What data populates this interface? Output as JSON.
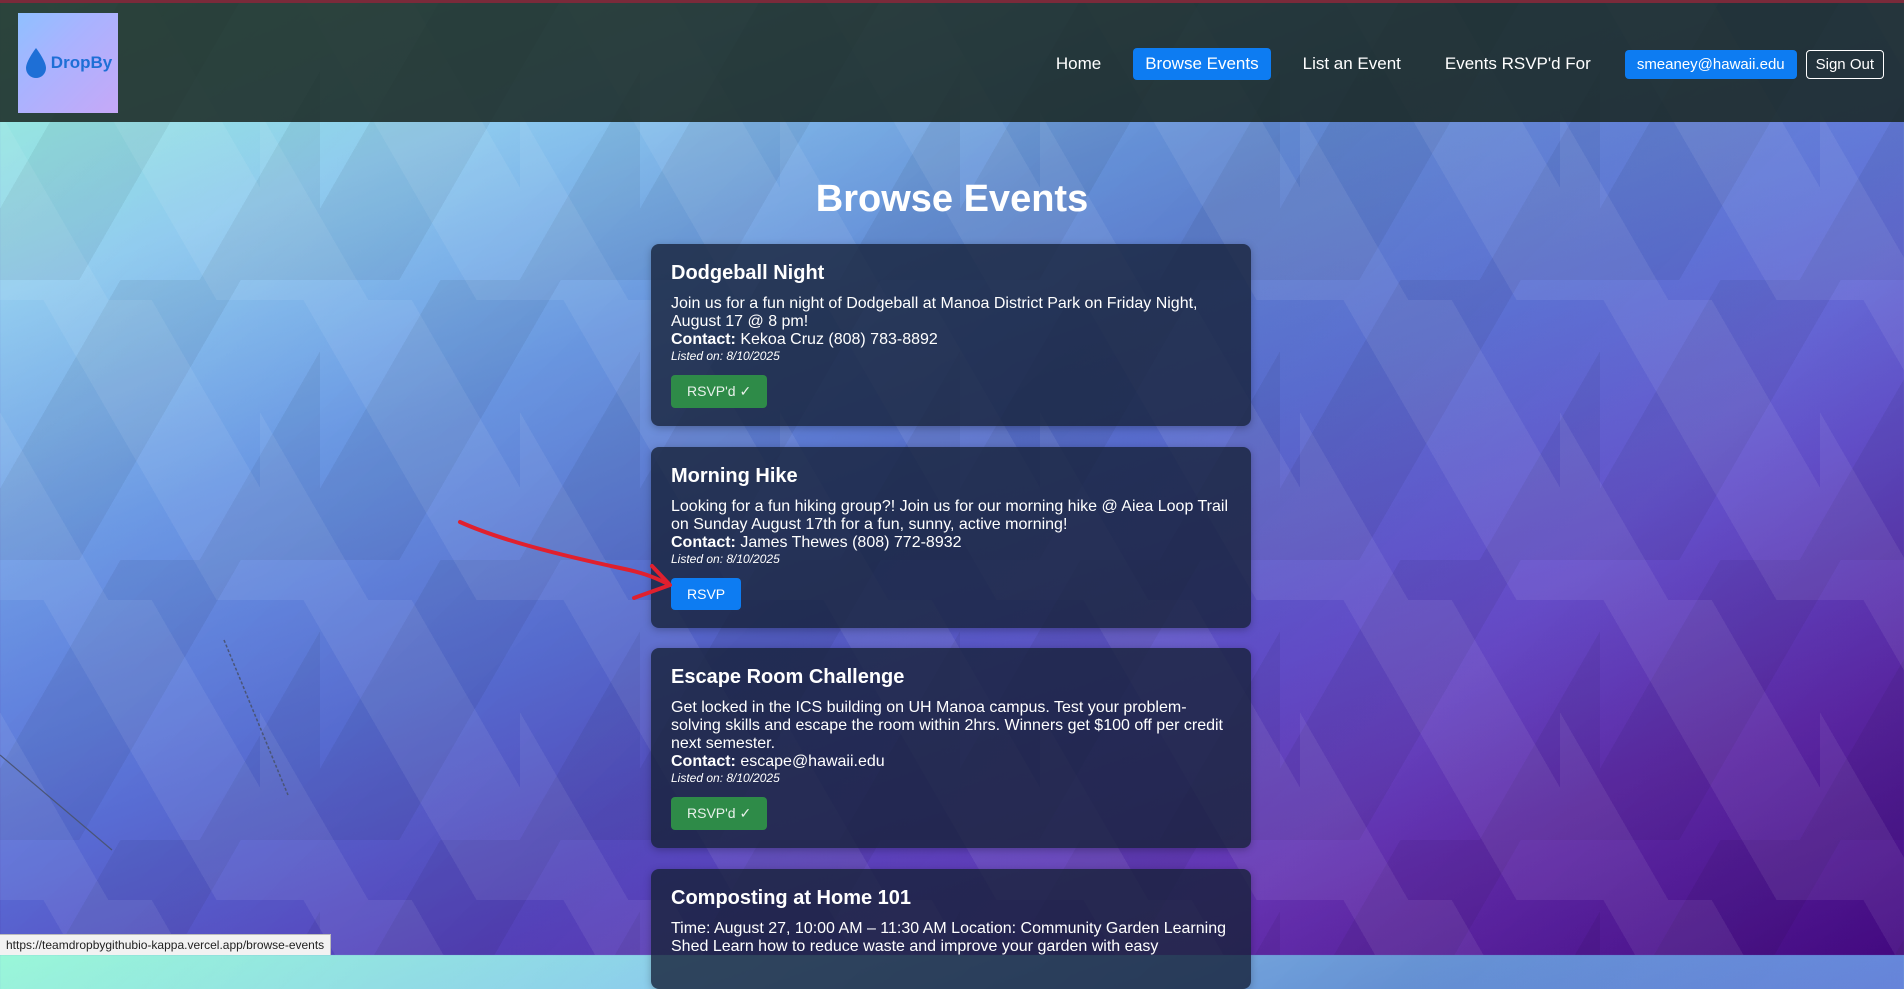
{
  "brand": {
    "name": "DropBy",
    "logo_icon": "water-drop-icon",
    "logo_color": "#1e6fd6"
  },
  "nav": {
    "links": [
      "Home",
      "Browse Events",
      "List an Event",
      "Events RSVP'd For"
    ],
    "active": "Browse Events",
    "user_email": "smeaney@hawaii.edu",
    "sign_out": "Sign Out"
  },
  "page": {
    "title": "Browse Events"
  },
  "contact_label": "Contact:",
  "events": [
    {
      "title": "Dodgeball Night",
      "description": "Join us for a fun night of Dodgeball at Manoa District Park on Friday Night, August 17 @ 8 pm!",
      "contact": "Kekoa Cruz (808) 783-8892",
      "listed": "Listed on: 8/10/2025",
      "button": "RSVP'd ✓",
      "rsvped": true
    },
    {
      "title": "Morning Hike",
      "description": "Looking for a fun hiking group?! Join us for our morning hike @ Aiea Loop Trail on Sunday August 17th for a fun, sunny, active morning!",
      "contact": "James Thewes (808) 772-8932",
      "listed": "Listed on: 8/10/2025",
      "button": "RSVP",
      "rsvped": false
    },
    {
      "title": "Escape Room Challenge",
      "description": "Get locked in the ICS building on UH Manoa campus. Test your problem-solving skills and escape the room within 2hrs. Winners get $100 off per credit next semester.",
      "contact": "escape@hawaii.edu",
      "listed": "Listed on: 8/10/2025",
      "button": "RSVP'd ✓",
      "rsvped": true
    },
    {
      "title": "Composting at Home 101",
      "description": "Time: August 27, 10:00 AM – 11:30 AM Location: Community Garden Learning Shed Learn how to reduce waste and improve your garden with easy",
      "contact": "",
      "listed": "",
      "button": "",
      "rsvped": false
    }
  ],
  "status_bar_url": "https://teamdropbygithubio-kappa.vercel.app/browse-events",
  "colors": {
    "primary": "#0d7cf2",
    "success": "#2e8b48",
    "annotation": "#e0202e"
  }
}
